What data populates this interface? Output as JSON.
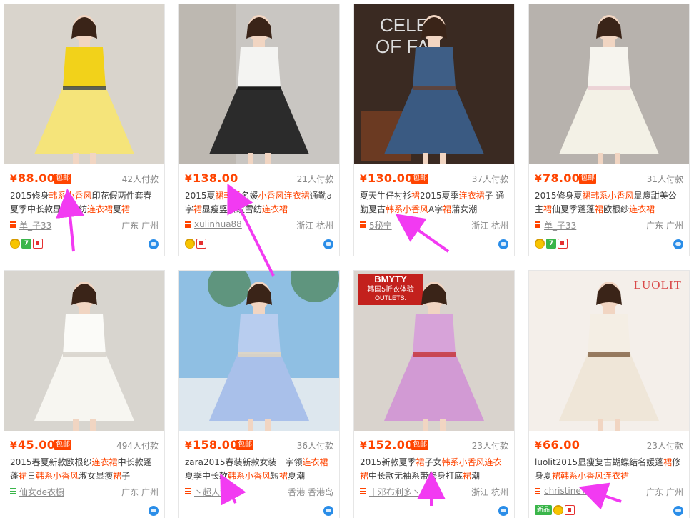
{
  "products": [
    {
      "price": "88.00",
      "free_shipping": "包邮",
      "sales": "42人付款",
      "title_parts": [
        {
          "t": "2015修身",
          "h": false
        },
        {
          "t": "韩系小香风",
          "h": true
        },
        {
          "t": "印花假两件套春夏季中长款显瘦雪纺",
          "h": false
        },
        {
          "t": "连衣裙",
          "h": true
        },
        {
          "t": "夏",
          "h": false
        },
        {
          "t": "裙",
          "h": true
        }
      ],
      "shop": "单_子33",
      "location": "广东 广州",
      "badges": [
        "gold-medal-icon",
        "seven-day-return-icon",
        "consumer-protection-icon"
      ],
      "photo_colors": {
        "bg": "#d9d4cc",
        "top": "#f2d21a",
        "skirt": "#f5e47a",
        "accent": "#1d2a44"
      }
    },
    {
      "price": "138.00",
      "free_shipping": "",
      "sales": "21人付款",
      "title_parts": [
        {
          "t": "2015夏",
          "h": false
        },
        {
          "t": "裙韩系",
          "h": true
        },
        {
          "t": "名媛",
          "h": false
        },
        {
          "t": "小香风连衣裙",
          "h": true
        },
        {
          "t": "通勤a字",
          "h": false
        },
        {
          "t": "裙",
          "h": true
        },
        {
          "t": "显瘦竖条纹雪纺",
          "h": false
        },
        {
          "t": "连衣裙",
          "h": true
        }
      ],
      "shop": "xulinhua88",
      "location": "浙江 杭州",
      "badges": [
        "gold-medal-icon",
        "consumer-protection-icon"
      ],
      "photo_colors": {
        "bg": "#c9c6c2",
        "top": "#f4f4f2",
        "skirt": "#2b2b2b",
        "accent": "#1b1b1b"
      }
    },
    {
      "price": "130.00",
      "free_shipping": "包邮",
      "sales": "37人付款",
      "title_parts": [
        {
          "t": "夏天牛仔衬衫",
          "h": false
        },
        {
          "t": "裙",
          "h": true
        },
        {
          "t": "2015夏季",
          "h": false
        },
        {
          "t": "连衣裙",
          "h": true
        },
        {
          "t": "子 通勤夏古",
          "h": false
        },
        {
          "t": "韩系小香风",
          "h": true
        },
        {
          "t": "A字",
          "h": false
        },
        {
          "t": "裙",
          "h": true
        },
        {
          "t": "蒲女潮",
          "h": false
        }
      ],
      "shop": "5秘宁",
      "location": "浙江 杭州",
      "badges": [],
      "photo_colors": {
        "bg": "#3a2a22",
        "top": "#3e5e86",
        "skirt": "#3a5a82",
        "accent": "#6b3a22"
      }
    },
    {
      "price": "78.00",
      "free_shipping": "包邮",
      "sales": "31人付款",
      "title_parts": [
        {
          "t": "2015修身夏",
          "h": false
        },
        {
          "t": "裙韩系小香风",
          "h": true
        },
        {
          "t": "显瘦甜美公主",
          "h": false
        },
        {
          "t": "裙",
          "h": true
        },
        {
          "t": "仙夏季蓬蓬",
          "h": false
        },
        {
          "t": "裙",
          "h": true
        },
        {
          "t": "欧根纱",
          "h": false
        },
        {
          "t": "连衣裙",
          "h": true
        }
      ],
      "shop": "单_子33",
      "location": "广东 广州",
      "badges": [
        "gold-medal-icon",
        "seven-day-return-icon",
        "consumer-protection-icon"
      ],
      "photo_colors": {
        "bg": "#b7b2ad",
        "top": "#f6f4ee",
        "skirt": "#f3f1e6",
        "accent": "#e8c6cf"
      }
    },
    {
      "price": "45.00",
      "free_shipping": "包邮",
      "sales": "494人付款",
      "title_parts": [
        {
          "t": "2015春夏新款欧根纱",
          "h": false
        },
        {
          "t": "连衣裙",
          "h": true
        },
        {
          "t": "中长款蓬蓬",
          "h": false
        },
        {
          "t": "裙",
          "h": true
        },
        {
          "t": "日",
          "h": false
        },
        {
          "t": "韩系小香风",
          "h": true
        },
        {
          "t": "淑女显瘦",
          "h": false
        },
        {
          "t": "裙",
          "h": true
        },
        {
          "t": "子",
          "h": false
        }
      ],
      "shop": "仙女de衣橱",
      "location": "广东 广州",
      "badges": [],
      "photo_colors": {
        "bg": "#d8d5cf",
        "top": "#fbfbf8",
        "skirt": "#f7f6f1",
        "accent": "#cfcac2"
      }
    },
    {
      "price": "158.00",
      "free_shipping": "包邮",
      "sales": "36人付款",
      "title_parts": [
        {
          "t": "zara2015春装新款女装一字领",
          "h": false
        },
        {
          "t": "连衣裙",
          "h": true
        },
        {
          "t": "夏季中长款",
          "h": false
        },
        {
          "t": "韩系小香风",
          "h": true
        },
        {
          "t": "短",
          "h": false
        },
        {
          "t": "裙",
          "h": true
        },
        {
          "t": "夏潮",
          "h": false
        }
      ],
      "shop": "丶超人驾到",
      "location": "香港 香港岛",
      "badges": [],
      "photo_colors": {
        "bg": "#8fbfe3",
        "top": "#b8cdef",
        "skirt": "#a9c0ea",
        "accent": "#e9d9b8"
      }
    },
    {
      "price": "152.00",
      "free_shipping": "包邮",
      "sales": "23人付款",
      "title_parts": [
        {
          "t": "2015新款夏季",
          "h": false
        },
        {
          "t": "裙",
          "h": true
        },
        {
          "t": "子女",
          "h": false
        },
        {
          "t": "韩系小香风连衣裙",
          "h": true
        },
        {
          "t": "中长款无袖系带修身打底",
          "h": false
        },
        {
          "t": "裙",
          "h": true
        },
        {
          "t": "潮",
          "h": false
        }
      ],
      "shop": "丨邓布利多丶",
      "location": "浙江 杭州",
      "badges": [],
      "banner_text": "BMYTY",
      "banner_sub": "韩国5折衣体验",
      "banner_sub2": "OUTLETS.",
      "photo_colors": {
        "bg": "#d9d3cd",
        "top": "#d7a3d9",
        "skirt": "#d29ad4",
        "accent": "#c3211d"
      }
    },
    {
      "price": "66.00",
      "free_shipping": "",
      "sales": "23人付款",
      "title_parts": [
        {
          "t": "luolit2015显瘦复古蝴蝶结名媛蓬",
          "h": false
        },
        {
          "t": "裙",
          "h": true
        },
        {
          "t": "修身夏",
          "h": false
        },
        {
          "t": "裙韩系小香风连衣裙",
          "h": true
        }
      ],
      "shop": "christine778",
      "location": "广东 广州",
      "badges": [
        "new-label-icon",
        "gold-medal-icon",
        "consumer-protection-icon"
      ],
      "new_label": "新品",
      "brand": "LUOLIT",
      "photo_colors": {
        "bg": "#f4efea",
        "top": "#f4eee4",
        "skirt": "#efe6d8",
        "accent": "#6f4a2a"
      }
    }
  ],
  "annotation_arrows": 8,
  "colors": {
    "price": "#ff4400",
    "highlight": "#ff4400",
    "arrow": "#f23af2"
  }
}
